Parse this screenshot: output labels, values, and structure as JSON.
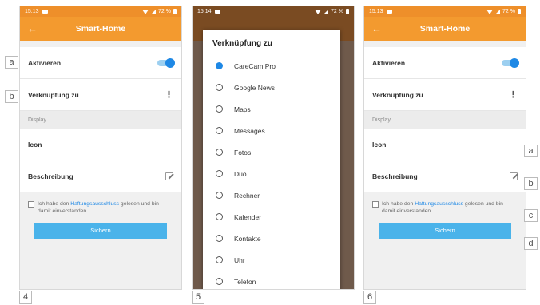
{
  "screens": [
    {
      "status_time": "15:13",
      "battery": "72 %",
      "title": "Smart-Home",
      "activate_label": "Aktivieren",
      "link_label": "Verknüpfung zu",
      "section_label": "Display",
      "icon_label": "Icon",
      "description_label": "Beschreibung",
      "disclaimer_pre": "Ich habe den ",
      "disclaimer_link": "Haftungsausschluss",
      "disclaimer_post": " gelesen und bin damit einverstanden",
      "save_label": "Sichern"
    },
    {
      "status_time": "15:14",
      "battery": "72 %",
      "dialog_title": "Verknüpfung zu",
      "options": [
        "CareCam Pro",
        "Google News",
        "Maps",
        "Messages",
        "Fotos",
        "Duo",
        "Rechner",
        "Kalender",
        "Kontakte",
        "Uhr",
        "Telefon"
      ],
      "selected_index": 0
    },
    {
      "status_time": "15:13",
      "battery": "72 %",
      "title": "Smart-Home",
      "activate_label": "Aktivieren",
      "link_label": "Verknüpfung zu",
      "section_label": "Display",
      "icon_label": "Icon",
      "description_label": "Beschreibung",
      "disclaimer_pre": "Ich habe den ",
      "disclaimer_link": "Haftungsausschluss",
      "disclaimer_post": " gelesen und bin damit einverstanden",
      "save_label": "Sichern"
    }
  ],
  "callouts_left": [
    "a",
    "b"
  ],
  "callouts_right": [
    "a",
    "b",
    "c",
    "d"
  ],
  "figure_numbers": [
    "4",
    "5",
    "6"
  ],
  "colors": {
    "status_bar": "#ee8f2a",
    "app_bar": "#f39a2f",
    "accent_blue": "#1e88e5",
    "button": "#4ab3ea"
  }
}
